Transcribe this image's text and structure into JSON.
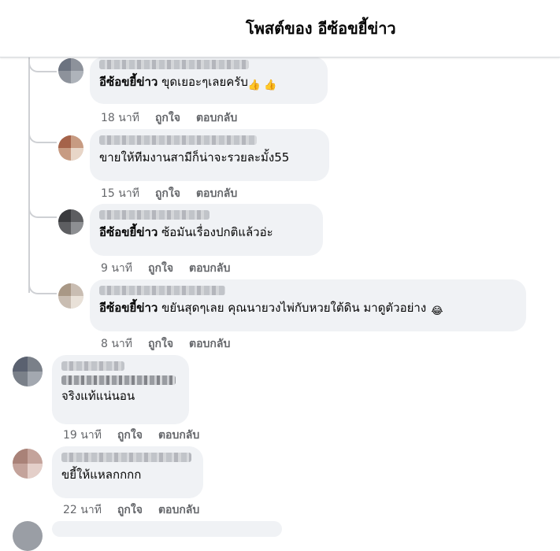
{
  "header": {
    "title": "โพสต์ของ อีซ้อขยี้ข่าว"
  },
  "comments": [
    {
      "author": "อีซ้อขยี้ข่าว",
      "text": "ขุดเยอะๆเลยครับ",
      "emoji": "👍 👍",
      "time": "18 นาที",
      "like": "ถูกใจ",
      "reply": "ตอบกลับ"
    },
    {
      "author": "",
      "text": "ขายให้ทีมงานสามีก็น่าจะรวยละมั้ง55",
      "emoji": "",
      "time": "15 นาที",
      "like": "ถูกใจ",
      "reply": "ตอบกลับ"
    },
    {
      "author": "อีซ้อขยี้ข่าว",
      "text": "ซ้อมันเรื่องปกติแล้วอ่ะ",
      "emoji": "",
      "time": "9 นาที",
      "like": "ถูกใจ",
      "reply": "ตอบกลับ"
    },
    {
      "author": "อีซ้อขยี้ข่าว",
      "text": "ขยันสุดๆเลย คุณนายวงไพ่กับหวยใต้ดิน มาดูตัวอย่าง",
      "emoji": "😂",
      "time": "8 นาที",
      "like": "ถูกใจ",
      "reply": "ตอบกลับ"
    },
    {
      "author": "",
      "text": "จริงแท้แน่นอน",
      "emoji": "",
      "time": "19 นาที",
      "like": "ถูกใจ",
      "reply": "ตอบกลับ"
    },
    {
      "author": "",
      "text": "ขยี้ให้แหลกกกก",
      "emoji": "",
      "time": "22 นาที",
      "like": "ถูกใจ",
      "reply": "ตอบกลับ"
    }
  ],
  "colors": {
    "bubble": "#f0f2f5",
    "meta": "#65676b",
    "thread": "#ced0d4"
  }
}
